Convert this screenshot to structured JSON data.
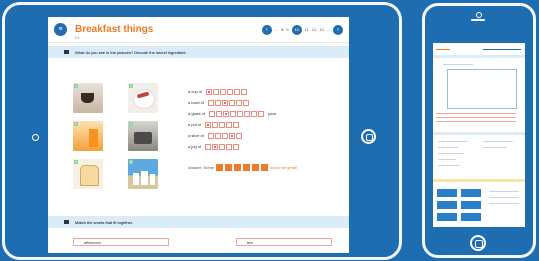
{
  "lesson": {
    "title": "Breakfast things",
    "subtitle": "B1",
    "pager": {
      "items": [
        "...",
        "8",
        "9",
        "10",
        "11",
        "12",
        "13",
        "..."
      ],
      "current": "10"
    }
  },
  "task1": {
    "instruction": "What do you see in the pictures? Decode the secret ingredient."
  },
  "pictures": [
    {
      "num": "1",
      "name": "coffee-cup"
    },
    {
      "num": "2",
      "name": "bacon-plate"
    },
    {
      "num": "3",
      "name": "orange-juice"
    },
    {
      "num": "4",
      "name": "saucepan-eggs"
    },
    {
      "num": "5",
      "name": "bread-slice"
    },
    {
      "num": "6",
      "name": "milk-jars"
    }
  ],
  "phrases": [
    {
      "label": "a cup of",
      "after": ""
    },
    {
      "label": "a bowl of",
      "after": ""
    },
    {
      "label": "a glass of",
      "after": "juice"
    },
    {
      "label": "a pot of",
      "after": ""
    },
    {
      "label": "a slice of",
      "after": ""
    },
    {
      "label": "a jug of",
      "after": ""
    }
  ],
  "answer": {
    "prefix": "Answer: Some",
    "suffix": "would be great!"
  },
  "task2": {
    "instruction": "Match the words that fit together."
  },
  "match": {
    "left": "afternoon",
    "right": "tea"
  },
  "colors": {
    "primary": "#1e6db0",
    "accent": "#f07a2a",
    "frame": "#f4f7fb"
  }
}
